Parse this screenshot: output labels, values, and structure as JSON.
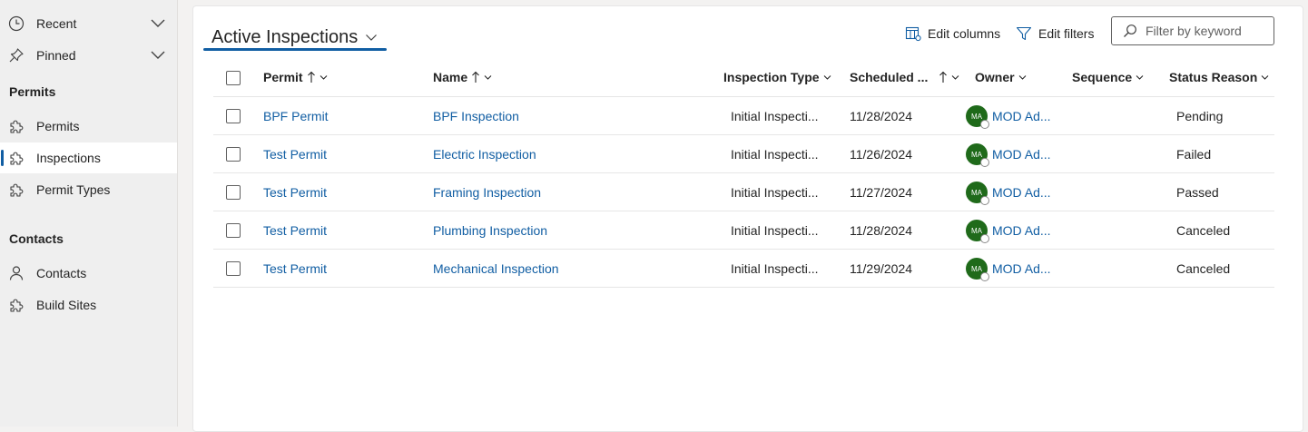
{
  "nav": {
    "recent": "Recent",
    "pinned": "Pinned",
    "permits_group": "Permits",
    "permits": "Permits",
    "inspections": "Inspections",
    "permit_types": "Permit Types",
    "contacts_group": "Contacts",
    "contacts": "Contacts",
    "build_sites": "Build Sites"
  },
  "view": {
    "title": "Active Inspections",
    "edit_columns": "Edit columns",
    "edit_filters": "Edit filters",
    "filter_placeholder": "Filter by keyword"
  },
  "columns": {
    "permit": "Permit",
    "name": "Name",
    "inspection_type": "Inspection Type",
    "scheduled": "Scheduled ...",
    "owner": "Owner",
    "sequence": "Sequence",
    "status_reason": "Status Reason"
  },
  "rows": [
    {
      "permit": "BPF Permit",
      "name": "BPF Inspection",
      "type": "Initial Inspecti...",
      "date": "11/28/2024",
      "initials": "MA",
      "owner": "MOD Ad...",
      "sequence": "",
      "status": "Pending"
    },
    {
      "permit": "Test Permit",
      "name": "Electric Inspection",
      "type": "Initial Inspecti...",
      "date": "11/26/2024",
      "initials": "MA",
      "owner": "MOD Ad...",
      "sequence": "",
      "status": "Failed"
    },
    {
      "permit": "Test Permit",
      "name": "Framing Inspection",
      "type": "Initial Inspecti...",
      "date": "11/27/2024",
      "initials": "MA",
      "owner": "MOD Ad...",
      "sequence": "",
      "status": "Passed"
    },
    {
      "permit": "Test Permit",
      "name": "Plumbing Inspection",
      "type": "Initial Inspecti...",
      "date": "11/28/2024",
      "initials": "MA",
      "owner": "MOD Ad...",
      "sequence": "",
      "status": "Canceled"
    },
    {
      "permit": "Test Permit",
      "name": "Mechanical Inspection",
      "type": "Initial Inspecti...",
      "date": "11/29/2024",
      "initials": "MA",
      "owner": "MOD Ad...",
      "sequence": "",
      "status": "Canceled"
    }
  ],
  "colors": {
    "accent": "#115ea3",
    "avatar": "#1f6a1a",
    "sidebar_bg": "#efefef"
  }
}
